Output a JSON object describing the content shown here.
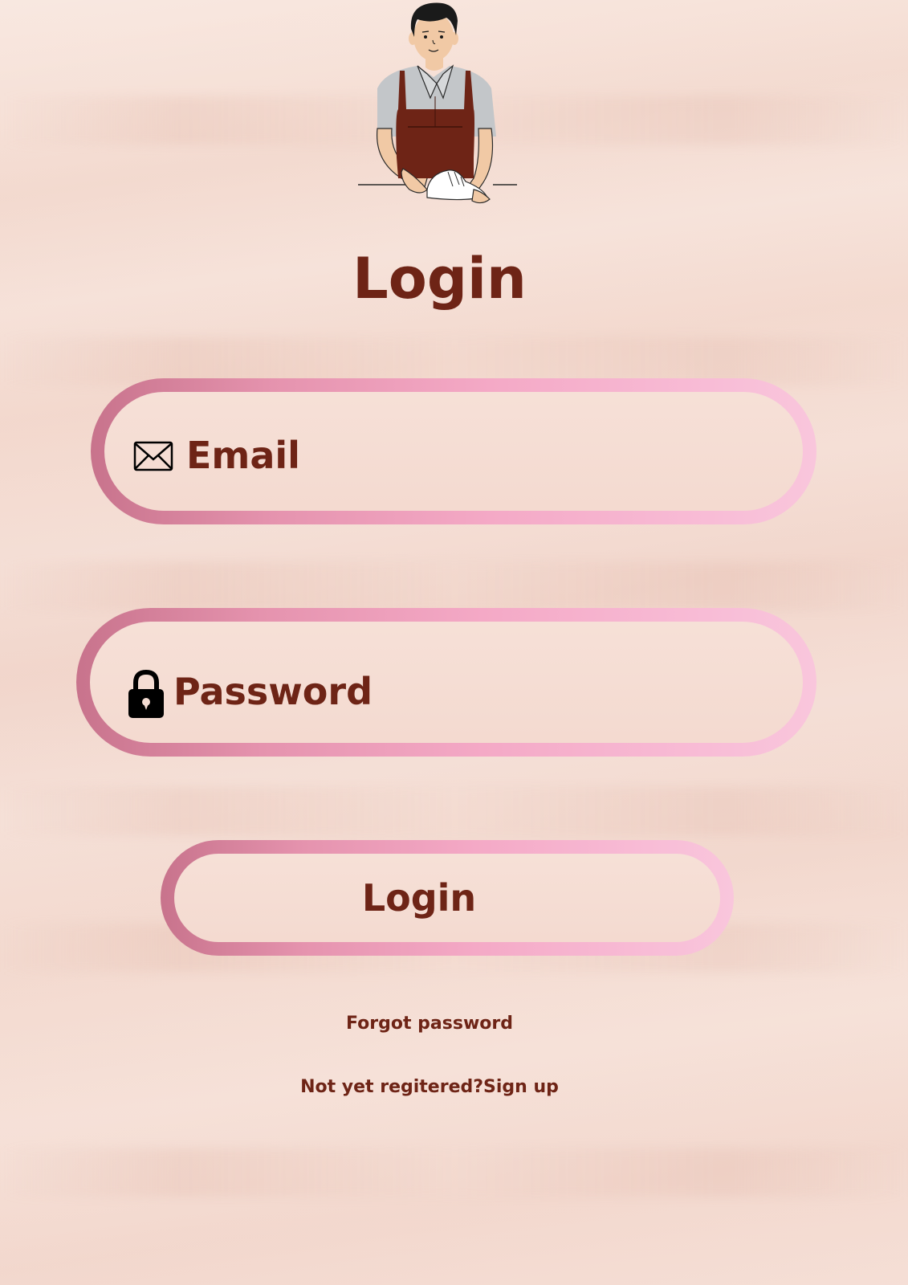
{
  "page": {
    "title": "Login"
  },
  "form": {
    "email_placeholder": "Email",
    "password_placeholder": "Password",
    "login_button_label": "Login"
  },
  "links": {
    "forgot_password": "Forgot password",
    "signup": "Not yet regitered?Sign up"
  },
  "colors": {
    "text": "#6e2416",
    "pill_gradient_start": "#c8738c",
    "pill_gradient_end": "#f9c6dc",
    "background": "#f4dcd2"
  },
  "icons": {
    "email": "envelope-icon",
    "password": "lock-icon"
  }
}
